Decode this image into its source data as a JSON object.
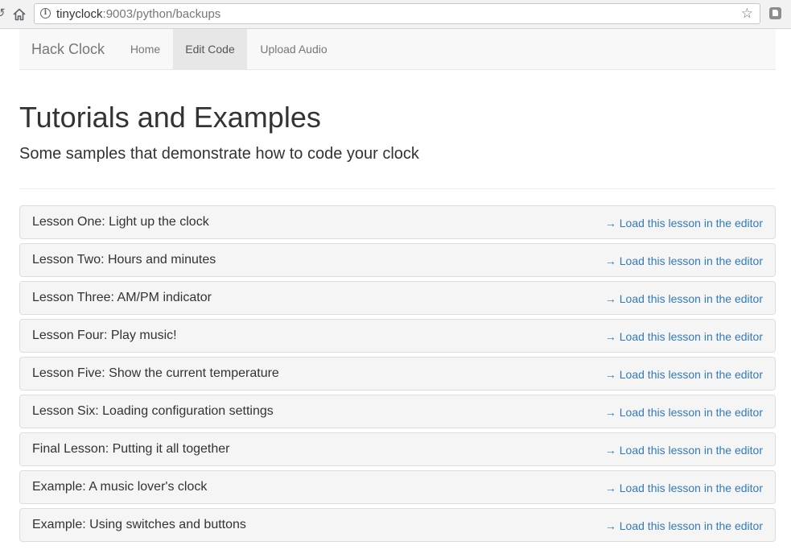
{
  "browser": {
    "url_host": "tinyclock",
    "url_rest": ":9003/python/backups",
    "icons": [
      "back-icon",
      "home-icon",
      "info-icon",
      "star-icon",
      "extension-icon"
    ]
  },
  "navbar": {
    "brand": "Hack Clock",
    "items": [
      {
        "label": "Home",
        "active": false
      },
      {
        "label": "Edit Code",
        "active": true
      },
      {
        "label": "Upload Audio",
        "active": false
      }
    ],
    "active_bg": "#e7e7e7"
  },
  "header": {
    "title": "Tutorials and Examples",
    "subtitle": "Some samples that demonstrate how to code your clock"
  },
  "lessons": [
    {
      "title": "Lesson One: Light up the clock",
      "link": "→ Load this lesson in the editor"
    },
    {
      "title": "Lesson Two: Hours and minutes",
      "link": "→ Load this lesson in the editor"
    },
    {
      "title": "Lesson Three: AM/PM indicator",
      "link": "→ Load this lesson in the editor"
    },
    {
      "title": "Lesson Four: Play music!",
      "link": "→ Load this lesson in the editor"
    },
    {
      "title": "Lesson Five: Show the current temperature",
      "link": "→ Load this lesson in the editor"
    },
    {
      "title": "Lesson Six: Loading configuration settings",
      "link": "→ Load this lesson in the editor"
    },
    {
      "title": "Final Lesson: Putting it all together",
      "link": "→ Load this lesson in the editor"
    },
    {
      "title": "Example: A music lover's clock",
      "link": "→ Load this lesson in the editor"
    },
    {
      "title": "Example: Using switches and buttons",
      "link": "→ Load this lesson in the editor"
    }
  ],
  "colors": {
    "link": "#337ab7",
    "panel_bg": "#f5f5f5",
    "panel_border": "#dddddd"
  }
}
